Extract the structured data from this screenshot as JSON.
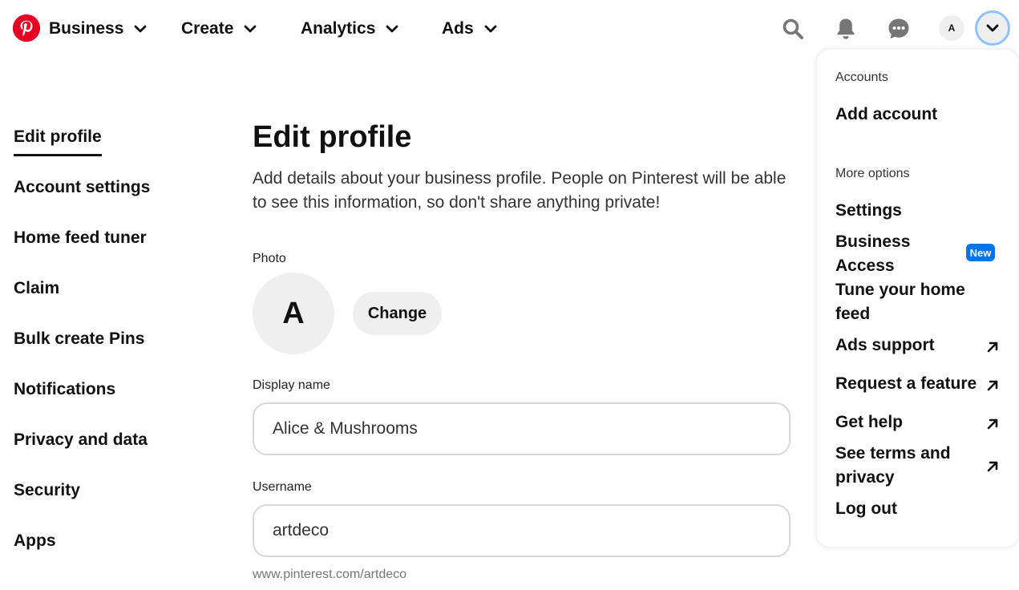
{
  "topnav": {
    "brand_icon": "pinterest-logo",
    "items": [
      {
        "label": "Business"
      },
      {
        "label": "Create"
      },
      {
        "label": "Analytics"
      },
      {
        "label": "Ads"
      }
    ],
    "icons": [
      "search-icon",
      "bell-icon",
      "chat-icon"
    ],
    "avatar_letter": "A",
    "account_toggle_icon": "chevron-down-icon"
  },
  "sidebar": {
    "items": [
      {
        "label": "Edit profile",
        "active": true
      },
      {
        "label": "Account settings"
      },
      {
        "label": "Home feed tuner"
      },
      {
        "label": "Claim"
      },
      {
        "label": "Bulk create Pins"
      },
      {
        "label": "Notifications"
      },
      {
        "label": "Privacy and data"
      },
      {
        "label": "Security"
      },
      {
        "label": "Apps"
      }
    ]
  },
  "main": {
    "title": "Edit profile",
    "description": "Add details about your business profile. People on Pinterest will be able to see this information, so don't share anything private!",
    "photo_label": "Photo",
    "photo_letter": "A",
    "change_label": "Change",
    "display_name_label": "Display name",
    "display_name_value": "Alice & Mushrooms",
    "username_label": "Username",
    "username_value": "artdeco",
    "profile_url": "www.pinterest.com/artdeco"
  },
  "dropdown": {
    "accounts_heading": "Accounts",
    "add_account": "Add account",
    "more_options_heading": "More options",
    "items": [
      {
        "label": "Settings"
      },
      {
        "label": "Business Access",
        "badge": "New"
      },
      {
        "label": "Tune your home feed"
      },
      {
        "label": "Ads support",
        "external": true
      },
      {
        "label": "Request a feature",
        "external": true
      },
      {
        "label": "Get help",
        "external": true
      },
      {
        "label": "See terms and privacy",
        "external": true
      },
      {
        "label": "Log out"
      }
    ]
  },
  "colors": {
    "brand": "#e60023",
    "badge": "#0074e8",
    "focus_ring": "#8fc2ff",
    "neutral_bg": "#efefef"
  }
}
